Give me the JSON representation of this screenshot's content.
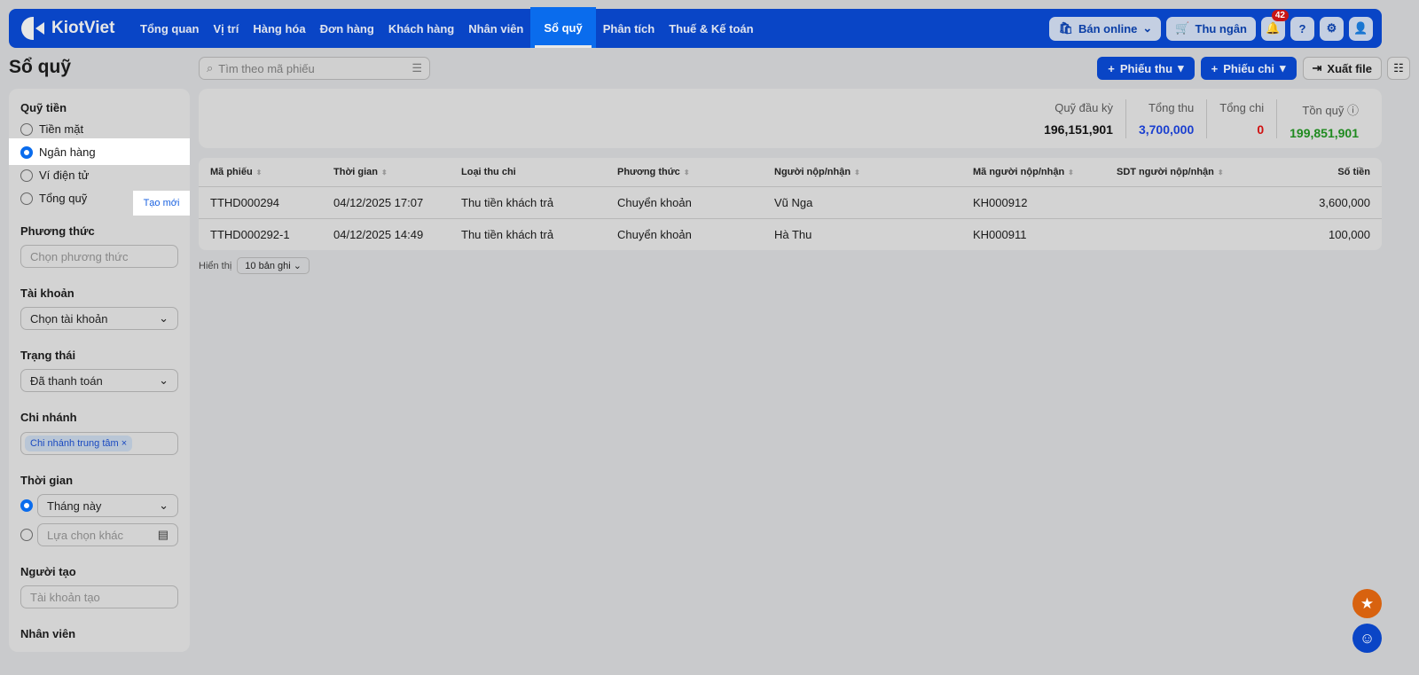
{
  "app": {
    "logo": "KiotViet"
  },
  "nav": {
    "tabs": [
      "Tổng quan",
      "Vị trí",
      "Hàng hóa",
      "Đơn hàng",
      "Khách hàng",
      "Nhân viên",
      "Sổ quỹ",
      "Phân tích",
      "Thuế & Kế toán"
    ],
    "active": "Sổ quỹ",
    "online_label": "Bán online",
    "cashier_label": "Thu ngân",
    "notif_count": "42"
  },
  "page": {
    "title": "Sổ quỹ",
    "search_placeholder": "Tìm theo mã phiếu",
    "receipt_btn": "Phiếu thu",
    "payment_btn": "Phiếu chi",
    "export_btn": "Xuất file"
  },
  "sidebar": {
    "fund_title": "Quỹ tiền",
    "funds": [
      "Tiền mặt",
      "Ngân hàng",
      "Ví điện tử",
      "Tổng quỹ"
    ],
    "selected_fund": "Ngân hàng",
    "method_title": "Phương thức",
    "method_placeholder": "Chọn phương thức",
    "account_title": "Tài khoản",
    "create_new": "Tạo mới",
    "account_placeholder": "Chọn tài khoản",
    "status_title": "Trạng thái",
    "status_value": "Đã thanh toán",
    "branch_title": "Chi nhánh",
    "branch_chip": "Chi nhánh trung tâm",
    "time_title": "Thời gian",
    "time_value": "Tháng này",
    "time_other": "Lựa chọn khác",
    "creator_title": "Người tạo",
    "creator_placeholder": "Tài khoản tạo",
    "staff_title": "Nhân viên"
  },
  "summary": [
    {
      "label": "Quỹ đầu kỳ",
      "value": "196,151,901",
      "color": "#111111"
    },
    {
      "label": "Tổng thu",
      "value": "3,700,000",
      "color": "#1a3fd0"
    },
    {
      "label": "Tổng chi",
      "value": "0",
      "color": "#d01010"
    },
    {
      "label": "Tồn quỹ",
      "value": "199,851,901",
      "color": "#1f8a1f"
    }
  ],
  "table": {
    "headers": [
      "Mã phiếu",
      "Thời gian",
      "Loại thu chi",
      "Phương thức",
      "Người nộp/nhận",
      "Mã người nộp/nhận",
      "SDT người nộp/nhận",
      "Số tiền"
    ],
    "rows": [
      [
        "TTHD000294",
        "04/12/2025 17:07",
        "Thu tiền khách trả",
        "Chuyển khoản",
        "Vũ Nga",
        "KH000912",
        "",
        "3,600,000"
      ],
      [
        "TTHD000292-1",
        "04/12/2025 14:49",
        "Thu tiền khách trả",
        "Chuyển khoản",
        "Hà Thu",
        "KH000911",
        "",
        "100,000"
      ]
    ]
  },
  "pagination": {
    "label": "Hiển thị",
    "page_size": "10 bản ghi"
  }
}
